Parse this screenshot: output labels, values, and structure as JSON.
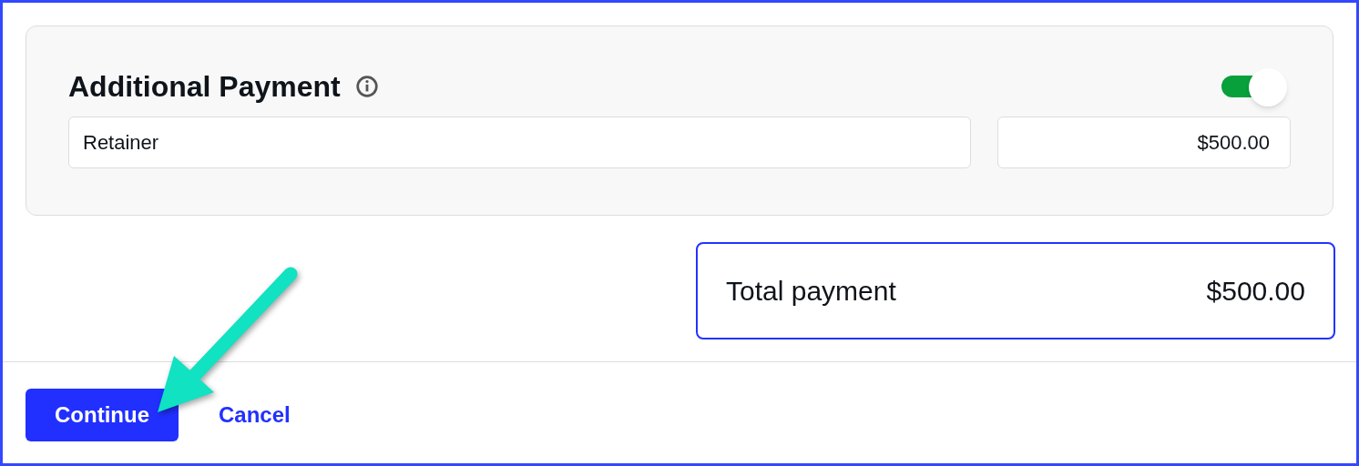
{
  "additional_payment": {
    "title": "Additional Payment",
    "toggle": {
      "on": true
    },
    "description_field": {
      "value": "Retainer"
    },
    "amount_field": {
      "value": "$500.00"
    }
  },
  "total": {
    "label": "Total payment",
    "value": "$500.00"
  },
  "buttons": [
    {
      "kind": "primary",
      "label": "Continue"
    },
    {
      "kind": "link",
      "label": "Cancel"
    }
  ]
}
